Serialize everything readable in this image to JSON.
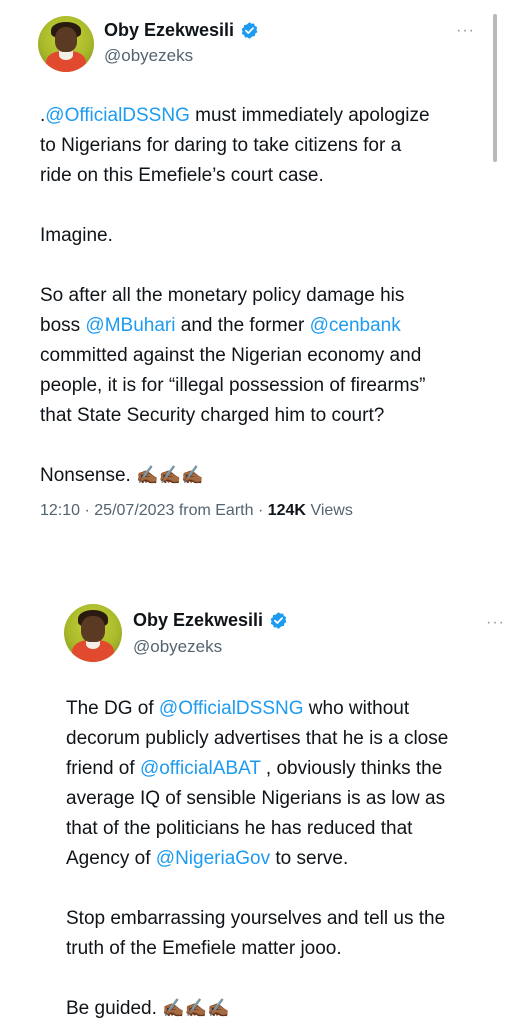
{
  "tweets": [
    {
      "author": {
        "name": "Oby Ezekwesili",
        "handle": "@obyezeks"
      },
      "more_label": "···",
      "lines": [
        [
          {
            "t": ".",
            "m": false
          },
          {
            "t": "@OfficialDSSNG",
            "m": true
          },
          {
            "t": "  must immediately apologize",
            "m": false
          }
        ],
        [
          {
            "t": "to Nigerians for daring to take citizens for a",
            "m": false
          }
        ],
        [
          {
            "t": "ride on this Emefiele’s court case.",
            "m": false
          }
        ],
        [],
        [
          {
            "t": "Imagine.",
            "m": false
          }
        ],
        [],
        [
          {
            "t": "So after all the monetary policy damage his",
            "m": false
          }
        ],
        [
          {
            "t": "boss ",
            "m": false
          },
          {
            "t": "@MBuhari",
            "m": true
          },
          {
            "t": " and the former ",
            "m": false
          },
          {
            "t": "@cenbank",
            "m": true
          }
        ],
        [
          {
            "t": "committed against the Nigerian economy and",
            "m": false
          }
        ],
        [
          {
            "t": "people, it is for “illegal possession of firearms”",
            "m": false
          }
        ],
        [
          {
            "t": "that State Security charged him to court?",
            "m": false
          }
        ],
        [],
        [
          {
            "t": "Nonsense. ",
            "m": false
          },
          {
            "t": "✍🏾✍🏾✍🏾",
            "e": true
          }
        ]
      ],
      "meta": {
        "time": "12:10",
        "date": "25/07/2023",
        "source": "from Earth",
        "views_count": "124K",
        "views_label": "Views"
      }
    },
    {
      "author": {
        "name": "Oby Ezekwesili",
        "handle": "@obyezeks"
      },
      "more_label": "···",
      "lines": [
        [
          {
            "t": "The DG of ",
            "m": false
          },
          {
            "t": "@OfficialDSSNG",
            "m": true
          },
          {
            "t": " who without",
            "m": false
          }
        ],
        [
          {
            "t": "decorum publicly advertises that he is a close",
            "m": false
          }
        ],
        [
          {
            "t": "friend of ",
            "m": false
          },
          {
            "t": "@officialABAT",
            "m": true
          },
          {
            "t": " , obviously thinks the",
            "m": false
          }
        ],
        [
          {
            "t": "average IQ of sensible Nigerians is as low as",
            "m": false
          }
        ],
        [
          {
            "t": "that of the politicians he has reduced that",
            "m": false
          }
        ],
        [
          {
            "t": "Agency of ",
            "m": false
          },
          {
            "t": "@NigeriaGov",
            "m": true
          },
          {
            "t": " to serve.",
            "m": false
          }
        ],
        [],
        [
          {
            "t": "Stop embarrassing yourselves and tell us the",
            "m": false
          }
        ],
        [
          {
            "t": "truth of the Emefiele matter jooo.",
            "m": false
          }
        ],
        [],
        [
          {
            "t": "Be guided. ",
            "m": false
          },
          {
            "t": "✍🏾✍🏾✍🏾",
            "e": true
          }
        ]
      ]
    }
  ],
  "colors": {
    "mention": "#1d9bf0",
    "verified": "#1d9bf0",
    "secondary_text": "#536471"
  },
  "icons": {
    "verified": "verified-badge-icon",
    "more": "more-options-icon"
  }
}
